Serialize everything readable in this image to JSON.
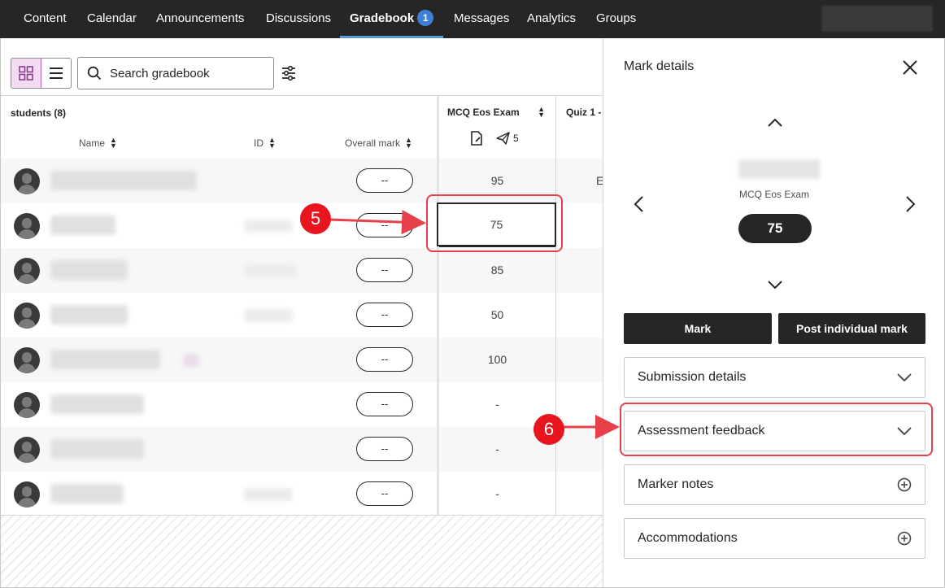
{
  "nav": {
    "tabs": [
      {
        "label": "Content"
      },
      {
        "label": "Calendar"
      },
      {
        "label": "Announcements"
      },
      {
        "label": "Discussions"
      },
      {
        "label": "Gradebook",
        "badge": "1"
      },
      {
        "label": "Messages"
      },
      {
        "label": "Analytics"
      },
      {
        "label": "Groups"
      }
    ],
    "active_tab": "Gradebook"
  },
  "toolbar": {
    "search_placeholder": "Search gradebook"
  },
  "table": {
    "students_header": "students (8)",
    "col_name": "Name",
    "col_id": "ID",
    "col_overall": "Overall mark",
    "mcq_header": "MCQ Eos Exam",
    "mcq_posted_count": "5",
    "quiz_header": "Quiz 1 -",
    "rows": [
      {
        "overall": "--",
        "mark": "95",
        "quiz": "E"
      },
      {
        "overall": "--",
        "mark": "75",
        "quiz": ""
      },
      {
        "overall": "--",
        "mark": "85",
        "quiz": ""
      },
      {
        "overall": "--",
        "mark": "50",
        "quiz": ""
      },
      {
        "overall": "--",
        "mark": "100",
        "quiz": ""
      },
      {
        "overall": "--",
        "mark": "-",
        "quiz": ""
      },
      {
        "overall": "--",
        "mark": "-",
        "quiz": ""
      },
      {
        "overall": "--",
        "mark": "-",
        "quiz": ""
      }
    ],
    "selected_row": 1
  },
  "callouts": {
    "step5": "5",
    "step6": "6"
  },
  "panel": {
    "title": "Mark details",
    "item_name": "MCQ Eos Exam",
    "mark": "75",
    "mark_button": "Mark",
    "post_button": "Post individual mark",
    "sections": [
      {
        "label": "Submission details",
        "icon": "chevron-down-icon"
      },
      {
        "label": "Assessment feedback",
        "icon": "chevron-down-icon"
      },
      {
        "label": "Marker notes",
        "icon": "plus-circle-icon"
      },
      {
        "label": "Accommodations",
        "icon": "plus-circle-icon"
      }
    ]
  },
  "colors": {
    "nav_bg": "#262626",
    "badge": "#3f7fd6",
    "callout_red": "#e8151f",
    "highlight_red": "#e6404a",
    "toggle_active": "#f3dcf3"
  }
}
